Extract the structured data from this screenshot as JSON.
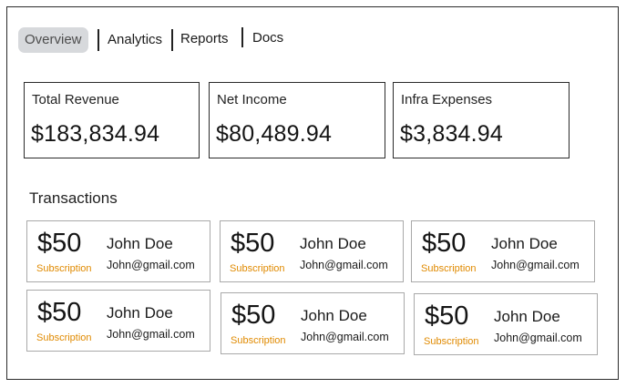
{
  "tabs": [
    {
      "label": "Overview",
      "active": true
    },
    {
      "label": "Analytics",
      "active": false
    },
    {
      "label": "Reports",
      "active": false
    },
    {
      "label": "Docs",
      "active": false
    }
  ],
  "summary": [
    {
      "label": "Total Revenue",
      "value": "$183,834.94"
    },
    {
      "label": "Net Income",
      "value": "$80,489.94"
    },
    {
      "label": "Infra Expenses",
      "value": "$3,834.94"
    }
  ],
  "transactions_title": "Transactions",
  "transactions": [
    {
      "amount": "$50",
      "type": "Subscription",
      "name": "John Doe",
      "email": "John@gmail.com"
    },
    {
      "amount": "$50",
      "type": "Subscription",
      "name": "John Doe",
      "email": "John@gmail.com"
    },
    {
      "amount": "$50",
      "type": "Subscription",
      "name": "John Doe",
      "email": "John@gmail.com"
    },
    {
      "amount": "$50",
      "type": "Subscription",
      "name": "John Doe",
      "email": "John@gmail.com"
    },
    {
      "amount": "$50",
      "type": "Subscription",
      "name": "John Doe",
      "email": "John@gmail.com"
    },
    {
      "amount": "$50",
      "type": "Subscription",
      "name": "John Doe",
      "email": "John@gmail.com"
    }
  ],
  "colors": {
    "accent_subscription": "#e08a00",
    "active_tab_bg": "#d7d9dc"
  }
}
